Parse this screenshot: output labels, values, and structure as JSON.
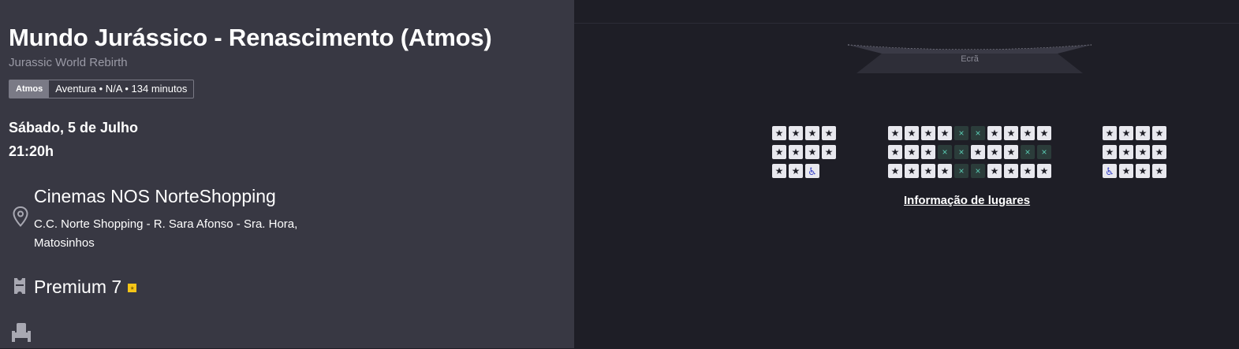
{
  "movie": {
    "title": "Mundo Jurássico - Renascimento (Atmos)",
    "original_title": "Jurassic World Rebirth",
    "format_tag": "Atmos",
    "info": "Aventura • N/A • 134 minutos"
  },
  "session": {
    "date": "Sábado, 5 de Julho",
    "time": "21:20h"
  },
  "cinema": {
    "name": "Cinemas NOS NorteShopping",
    "address": "C.C. Norte Shopping - R. Sara Afonso - Sra. Hora, Matosinhos",
    "room": "Premium 7"
  },
  "seat_map": {
    "screen_label": "Ecrã",
    "info_link": "Informação de lugares",
    "symbols": {
      "premium": "★",
      "occupied": "×",
      "accessible": "♿"
    },
    "blocks": [
      {
        "id": "left",
        "rows": [
          [
            "P",
            "P",
            "P",
            "P"
          ],
          [
            "P",
            "P",
            "P",
            "P"
          ],
          [
            "P",
            "P",
            "A"
          ]
        ]
      },
      {
        "id": "center",
        "rows": [
          [
            "P",
            "P",
            "P",
            "P",
            "X",
            "X",
            "P",
            "P",
            "P",
            "P"
          ],
          [
            "P",
            "P",
            "P",
            "X",
            "X",
            "P",
            "P",
            "P",
            "X",
            "X"
          ],
          [
            "P",
            "P",
            "P",
            "P",
            "X",
            "X",
            "P",
            "P",
            "P",
            "P"
          ]
        ]
      },
      {
        "id": "right",
        "rows": [
          [
            "P",
            "P",
            "P",
            "P"
          ],
          [
            "P",
            "P",
            "P",
            "P"
          ],
          [
            "A",
            "P",
            "P",
            "P"
          ]
        ]
      }
    ]
  },
  "icons": {
    "location": "map-pin-icon",
    "room": "ticket-icon",
    "seat": "seat-icon"
  },
  "colors": {
    "panel": "#383843",
    "background": "#1e1e26",
    "premium_badge": "#f5c518",
    "occupied": "#58c7b0",
    "accessible": "#3a45c8"
  }
}
